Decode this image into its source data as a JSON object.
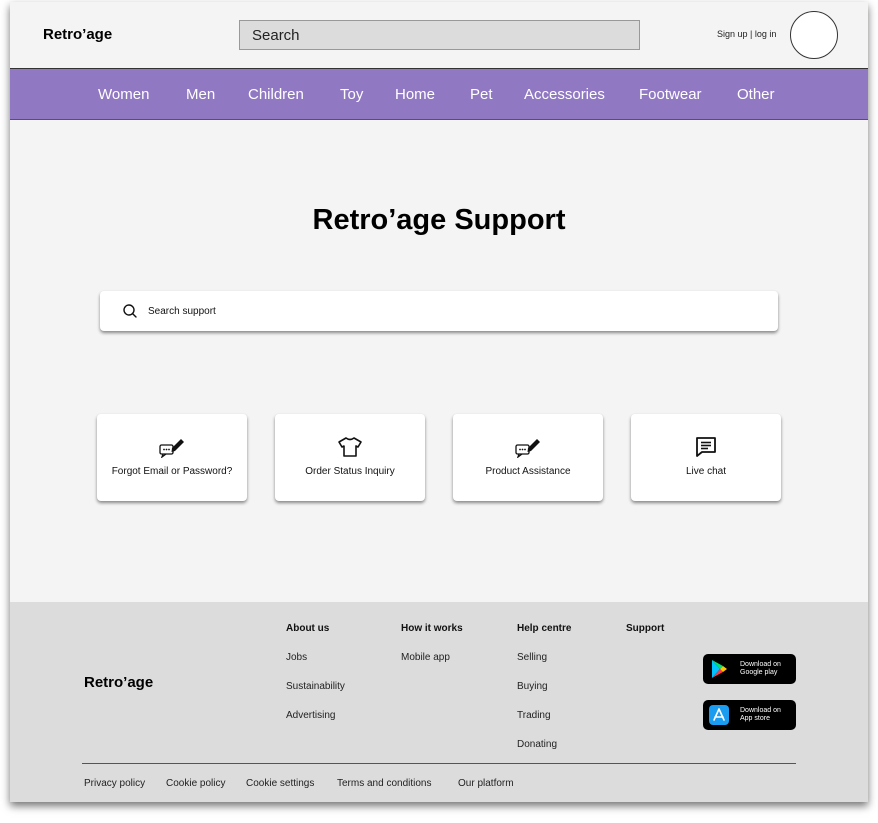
{
  "header": {
    "logo": "Retro’age",
    "search_placeholder": "Search",
    "auth_text": "Sign up | log in"
  },
  "nav": {
    "items": [
      "Women",
      "Men",
      "Children",
      "Toy",
      "Home",
      "Pet",
      "Accessories",
      "Footwear",
      "Other"
    ]
  },
  "main": {
    "title": "Retro’age Support",
    "search_placeholder": "Search support",
    "cards": [
      {
        "label": "Forgot Email or Password?",
        "icon": "chat-edit-icon"
      },
      {
        "label": "Order Status Inquiry",
        "icon": "tshirt-icon"
      },
      {
        "label": "Product Assistance",
        "icon": "chat-edit-icon"
      },
      {
        "label": "Live chat",
        "icon": "message-icon"
      }
    ]
  },
  "footer": {
    "logo": "Retro’age",
    "columns": [
      {
        "heading": "About us",
        "links": [
          "Jobs",
          "Sustainability",
          "Advertising"
        ]
      },
      {
        "heading": "How it works",
        "links": [
          "Mobile app"
        ]
      },
      {
        "heading": "Help centre",
        "links": [
          "Selling",
          "Buying",
          "Trading",
          "Donating"
        ]
      },
      {
        "heading": "Support",
        "links": []
      }
    ],
    "stores": [
      {
        "line1": "Download on",
        "line2": "Google play",
        "icon": "google-play-icon"
      },
      {
        "line1": "Download on",
        "line2": "App store",
        "icon": "app-store-icon"
      }
    ],
    "legal": [
      "Privacy policy",
      "Cookie policy",
      "Cookie settings",
      "Terms and conditions",
      "Our platform"
    ]
  },
  "colors": {
    "nav_bg": "#9078c2",
    "page_bg": "#f4f4f4",
    "footer_bg": "#dcdcdc"
  }
}
